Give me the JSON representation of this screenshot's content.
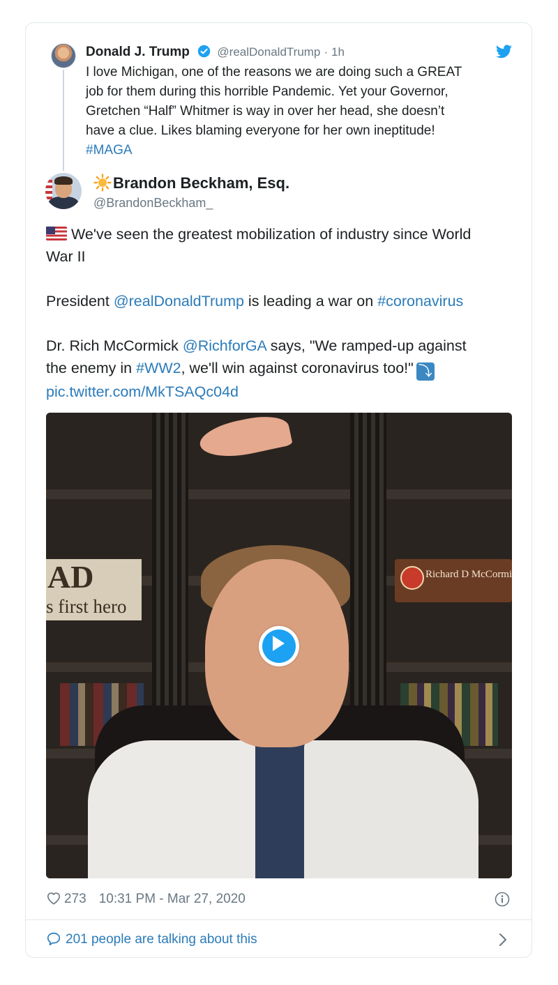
{
  "parent_tweet": {
    "author_name": "Donald J. Trump",
    "handle": "@realDonaldTrump",
    "time": "· 1h",
    "text_lines": [
      "I love Michigan, one of the reasons we are doing such a GREAT",
      "job for them during this horrible Pandemic. Yet your Governor,",
      "Gretchen “Half” Whitmer is way in over her head, she doesn’t",
      "have a clue. Likes blaming everyone for her own ineptitude!"
    ],
    "hashtag": "#MAGA"
  },
  "tweet": {
    "author_name": "Brandon Beckham, Esq.",
    "handle": "@BrandonBeckham_",
    "line1": "We've seen the greatest mobilization of industry since World",
    "line2": "War II",
    "p2_prefix": "President ",
    "p2_mention": "@realDonaldTrump",
    "p2_mid": " is leading a war on ",
    "p2_hashtag": "#coronavirus",
    "p3_prefix": "Dr. Rich McCormick ",
    "p3_mention": "@RichforGA",
    "p3_suffix": " says, \"We ramped-up against",
    "p4_prefix": "the enemy in ",
    "p4_hashtag": "#WW2",
    "p4_suffix": ", we'll win against coronavirus too!\"",
    "arrow_glyph": "⤵",
    "pic_link": "pic.twitter.com/MkTSAQc04d"
  },
  "video": {
    "sign_big": "AD",
    "sign_small": "s first hero",
    "plaque_text": "Richard D McCormick"
  },
  "footer": {
    "likes": "273",
    "timestamp": "10:31 PM - Mar 27, 2020",
    "talking": "201 people are talking about this"
  },
  "icons": {
    "verified": "verified-badge-icon",
    "twitter": "twitter-bird-icon",
    "heart": "heart-icon",
    "info": "info-icon",
    "bubble": "speech-bubble-icon",
    "chevron": "chevron-right-icon"
  },
  "colors": {
    "link": "#2b7bb9",
    "twitter_blue": "#1da1f2",
    "muted": "#697882"
  }
}
